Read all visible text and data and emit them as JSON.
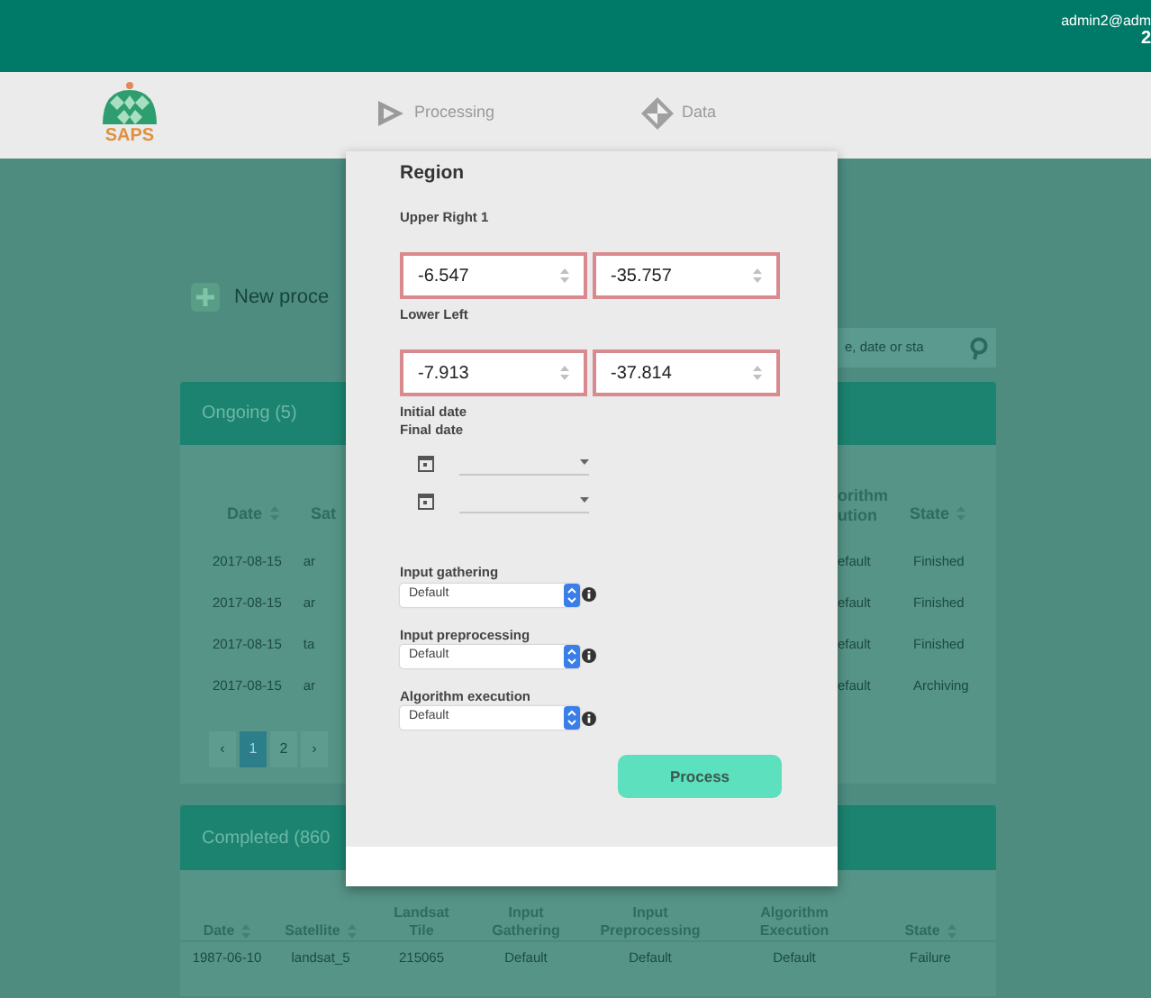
{
  "top_bar": {
    "user": "admin2@adm",
    "user_line_2": "2"
  },
  "header": {
    "logo_text": "SAPS",
    "nav": [
      {
        "label": "Processing",
        "kind": "processing"
      },
      {
        "label": "Data",
        "kind": "data"
      }
    ]
  },
  "background": {
    "new_process": "New proce",
    "search_placeholder": "e, date or sta",
    "ongoing": {
      "title": "Ongoing (5)",
      "left_columns": [
        "Date",
        "Sat"
      ],
      "right_columns": [
        "orithm\nution",
        "State"
      ],
      "rows": [
        {
          "date": "2017-08-15",
          "col_2": "ar",
          "col_5": "efault",
          "state": "Finished"
        },
        {
          "date": "2017-08-15",
          "col_2": "ar",
          "col_5": "efault",
          "state": "Finished"
        },
        {
          "date": "2017-08-15",
          "col_2": "ta",
          "col_5": "efault",
          "state": "Finished"
        },
        {
          "date": "2017-08-15",
          "col_2": "ar",
          "col_5": "efault",
          "state": "Archiving"
        }
      ],
      "pages": [
        {
          "label": "‹",
          "selected": false
        },
        {
          "label": "1",
          "selected": true
        },
        {
          "label": "2",
          "selected": false
        },
        {
          "label": "›",
          "selected": false
        }
      ]
    },
    "completed": {
      "title": "Completed (860",
      "columns": [
        "Date",
        "Satellite",
        "Landsat\nTile",
        "Input\nGathering",
        "Input\nPreprocessing",
        "Algorithm\nExecution",
        "State"
      ],
      "rows": [
        [
          "1987-06-10",
          "landsat_5",
          "215065",
          "Default",
          "Default",
          "Default",
          "Failure"
        ]
      ]
    }
  },
  "modal": {
    "title": "Region",
    "upper_right": {
      "label": "Upper Right 1",
      "fields": [
        {
          "value": "-6.547",
          "invalid": true
        },
        {
          "value": "-35.757",
          "invalid": true
        }
      ]
    },
    "lower_left": {
      "label": "Lower Left",
      "fields": [
        {
          "value": "-7.913",
          "invalid": true
        },
        {
          "value": "-37.814",
          "invalid": true
        }
      ]
    },
    "date_labels": [
      "Initial date",
      "Final date"
    ],
    "date_pickers": [
      {
        "kind": "date"
      },
      {
        "kind": "date"
      }
    ],
    "selects": [
      {
        "label": "Input gathering",
        "value": "Default"
      },
      {
        "label": "Input preprocessing",
        "value": "Default"
      },
      {
        "label": "Algorithm execution",
        "value": "Default"
      }
    ],
    "button": "Process"
  }
}
